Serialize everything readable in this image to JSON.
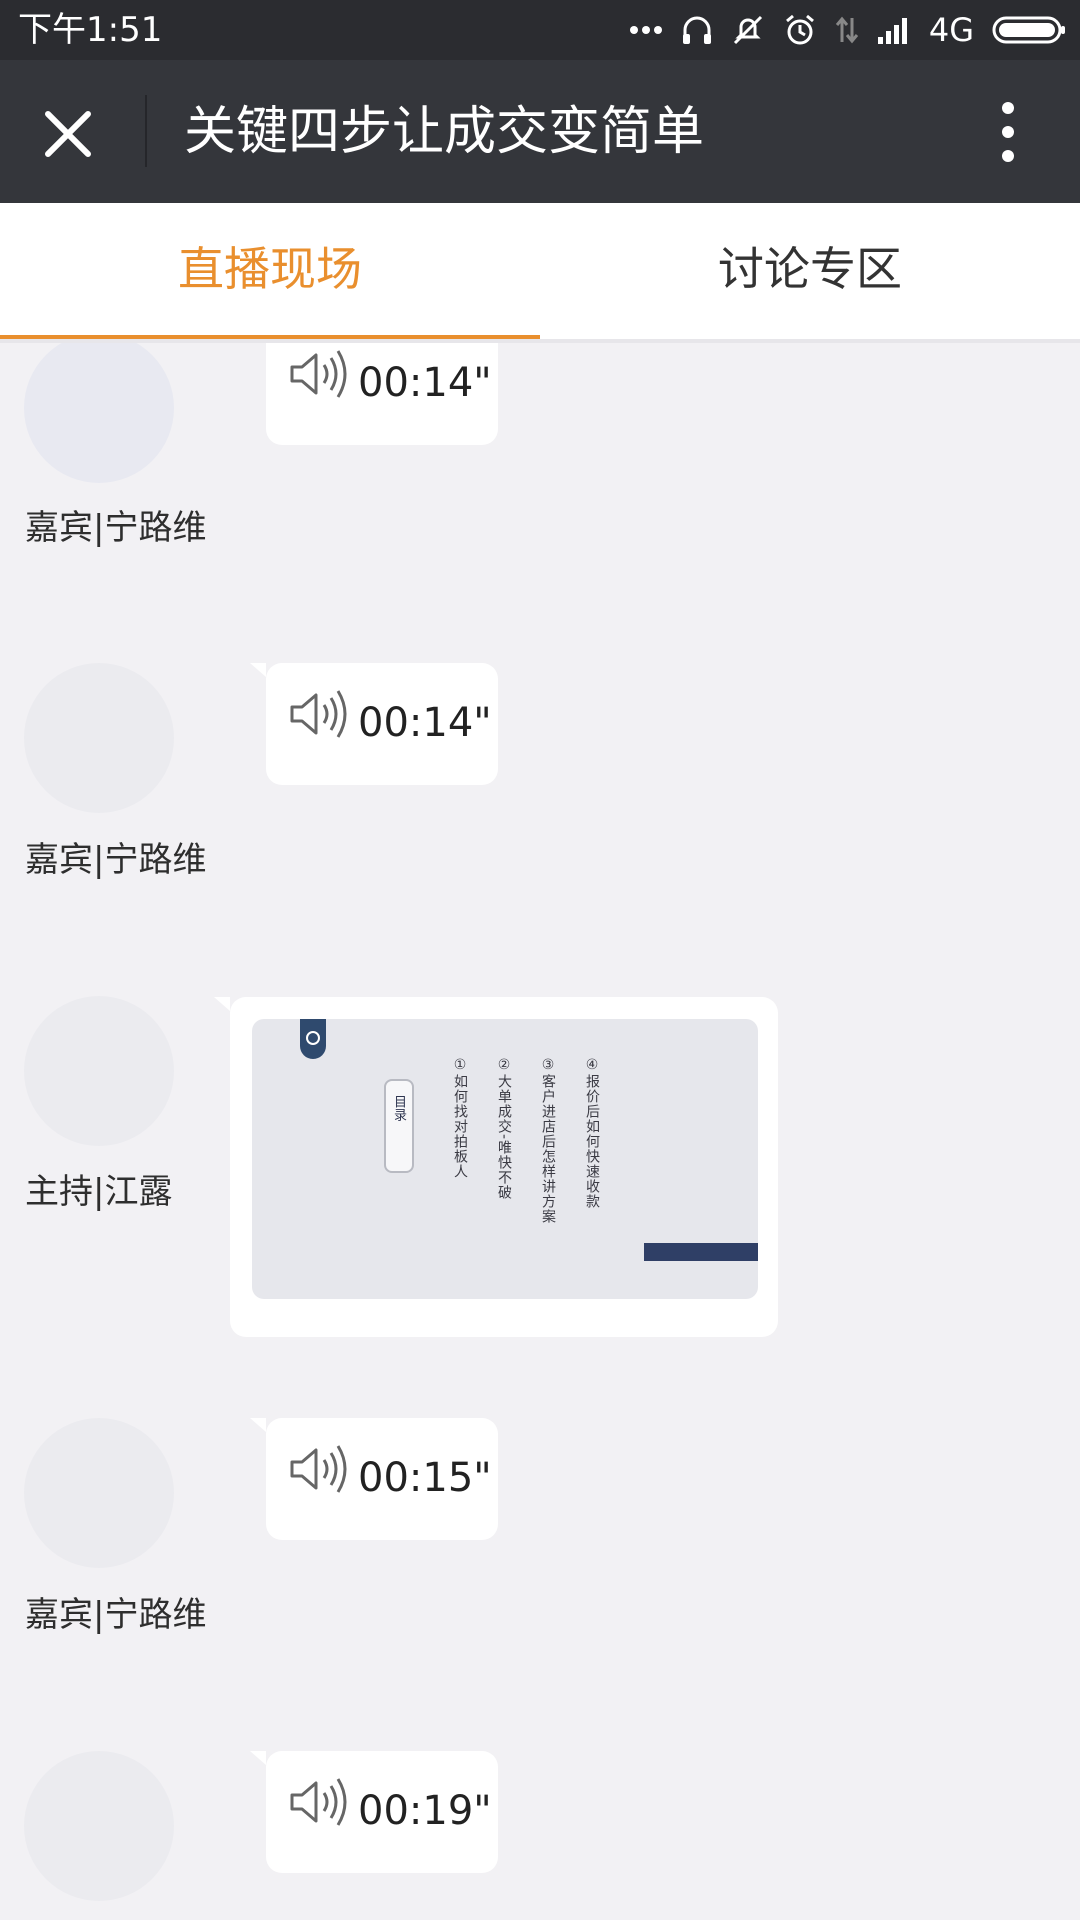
{
  "status_bar": {
    "time": "下午1:51",
    "network": "4G",
    "icons": [
      "more-dots-icon",
      "headset-icon",
      "vibrate-off-icon",
      "alarm-icon",
      "data-arrows-icon",
      "signal-icon",
      "battery-icon"
    ]
  },
  "app_bar": {
    "title": "关键四步让成交变简单",
    "close_icon": "close-icon",
    "more_icon": "more-vertical-icon"
  },
  "tabs": [
    {
      "label": "直播现场",
      "active": true
    },
    {
      "label": "讨论专区",
      "active": false
    }
  ],
  "colors": {
    "accent": "#e98f2e",
    "app_bar": "#34363b",
    "status_bar": "#2b2c30",
    "feed_background": "#f2f1f4"
  },
  "messages": [
    {
      "type": "voice",
      "duration": "00:14\"",
      "sender": "嘉宾|宁路维"
    },
    {
      "type": "voice",
      "duration": "00:14\"",
      "sender": "嘉宾|宁路维"
    },
    {
      "type": "image",
      "sender": "主持|江露",
      "slide": {
        "title": "目录",
        "items": [
          "①如何找对拍板人",
          "②大单成交-唯快不破",
          "③客户进店后怎样讲方案",
          "④报价后如何快速收款"
        ]
      }
    },
    {
      "type": "voice",
      "duration": "00:15\"",
      "sender": "嘉宾|宁路维"
    },
    {
      "type": "voice",
      "duration": "00:19\""
    }
  ]
}
